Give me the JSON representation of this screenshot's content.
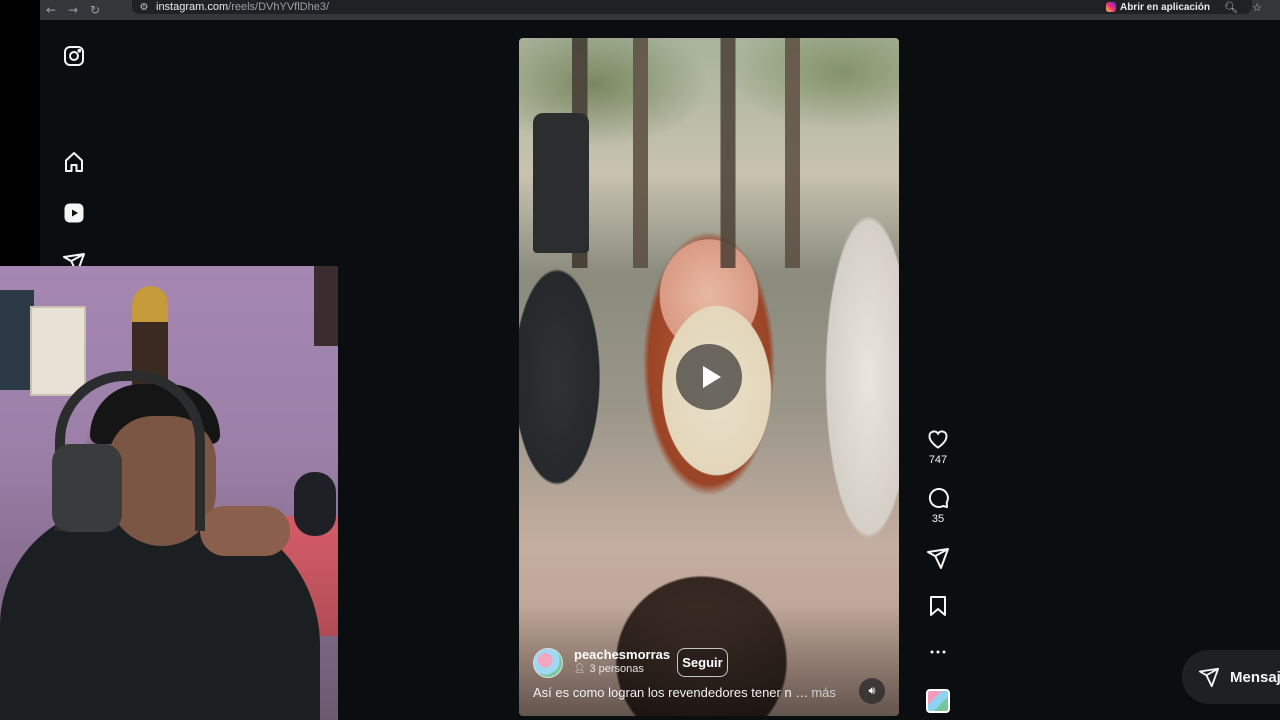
{
  "browser": {
    "url_host": "instagram.com",
    "url_path": "/reels/DVhYVflDhe3/",
    "open_app_label": "Abrir en aplicación"
  },
  "sidebar": {
    "icons": [
      "instagram-logo-icon",
      "home-icon",
      "reels-icon",
      "direct-icon"
    ]
  },
  "reel": {
    "author": {
      "username": "peachesmorras",
      "subtitle": "3 personas"
    },
    "follow_label": "Seguir",
    "caption": "Así es como logran los revendedores tener n …",
    "caption_more": "más",
    "playing": false,
    "muted": false
  },
  "actions": {
    "likes": "747",
    "comments": "35",
    "share_icon": "send-icon",
    "save_icon": "bookmark-icon",
    "more_icon": "ellipsis-icon"
  },
  "messages": {
    "label": "Mensajes"
  },
  "colors": {
    "page_bg": "#0b0e10",
    "browser_bg": "#35363a",
    "text": "#f5f5f5"
  }
}
